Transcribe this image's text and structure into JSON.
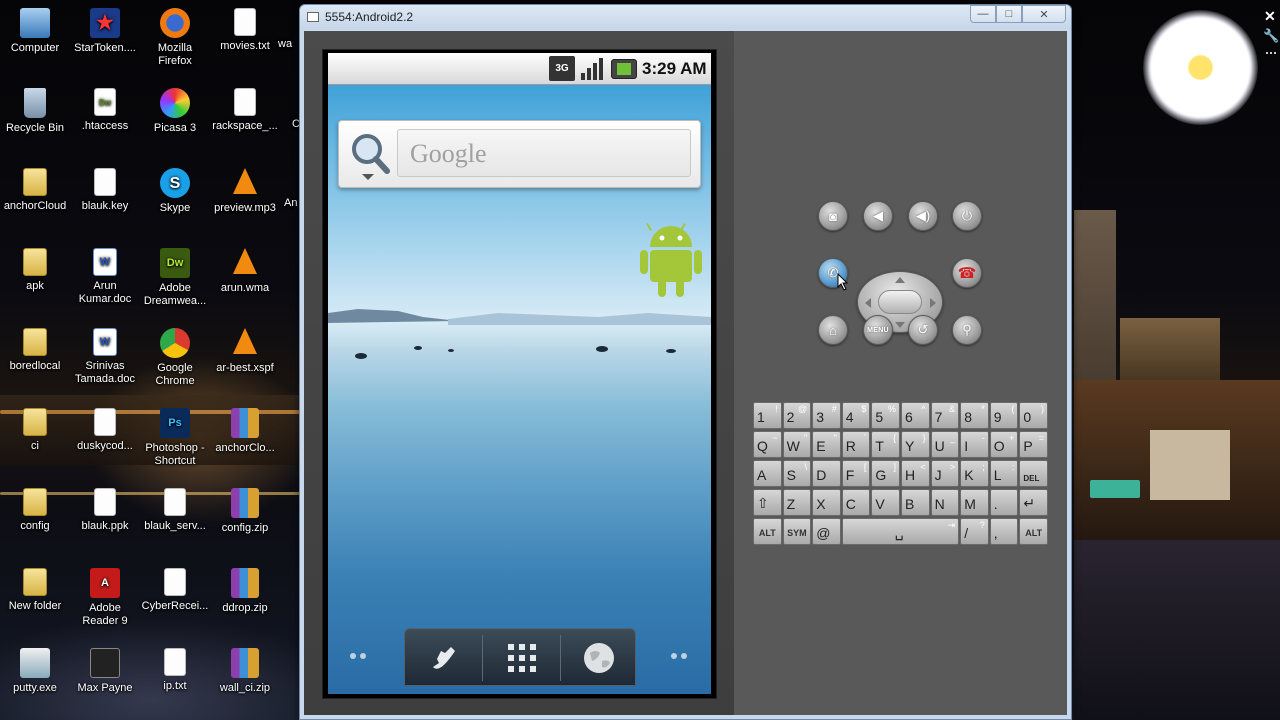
{
  "window": {
    "title": "5554:Android2.2",
    "minimize_label": "—",
    "maximize_label": "□",
    "close_label": "✕"
  },
  "desktop_icons": [
    {
      "label": "Computer",
      "kind": "computer"
    },
    {
      "label": "StarToken....",
      "kind": "star"
    },
    {
      "label": "Mozilla Firefox",
      "kind": "firefox"
    },
    {
      "label": "movies.txt",
      "kind": "file"
    },
    {
      "label": "Recycle Bin",
      "kind": "recycle"
    },
    {
      "label": ".htaccess",
      "kind": "dw"
    },
    {
      "label": "Picasa 3",
      "kind": "picasa"
    },
    {
      "label": "rackspace_...",
      "kind": "file"
    },
    {
      "label": "anchorCloud",
      "kind": "folder"
    },
    {
      "label": "blauk.key",
      "kind": "file"
    },
    {
      "label": "Skype",
      "kind": "skype"
    },
    {
      "label": "preview.mp3",
      "kind": "vlc"
    },
    {
      "label": "apk",
      "kind": "folder"
    },
    {
      "label": "Arun Kumar.doc",
      "kind": "doc"
    },
    {
      "label": "Adobe Dreamwea...",
      "kind": "dreamweaver"
    },
    {
      "label": "arun.wma",
      "kind": "vlc"
    },
    {
      "label": "boredlocal",
      "kind": "folder"
    },
    {
      "label": "Srinivas Tamada.doc",
      "kind": "doc"
    },
    {
      "label": "Google Chrome",
      "kind": "chrome"
    },
    {
      "label": "ar-best.xspf",
      "kind": "vlc"
    },
    {
      "label": "ci",
      "kind": "folder"
    },
    {
      "label": "duskycod...",
      "kind": "file"
    },
    {
      "label": "Photoshop - Shortcut",
      "kind": "photoshop"
    },
    {
      "label": "anchorClo...",
      "kind": "zip"
    },
    {
      "label": "config",
      "kind": "folder"
    },
    {
      "label": "blauk.ppk",
      "kind": "file"
    },
    {
      "label": "blauk_serv...",
      "kind": "file"
    },
    {
      "label": "config.zip",
      "kind": "zip"
    },
    {
      "label": "New folder",
      "kind": "folder"
    },
    {
      "label": "Adobe Reader 9",
      "kind": "reader"
    },
    {
      "label": "CyberRecei...",
      "kind": "file"
    },
    {
      "label": "ddrop.zip",
      "kind": "zip"
    },
    {
      "label": "putty.exe",
      "kind": "putty"
    },
    {
      "label": "Max Payne",
      "kind": "maxpayne"
    },
    {
      "label": "ip.txt",
      "kind": "file"
    },
    {
      "label": "wall_ci.zip",
      "kind": "zip"
    }
  ],
  "desktop_partial_labels": [
    "wa",
    "An",
    "C"
  ],
  "phone": {
    "status": {
      "network": "3G",
      "time": "3:29 AM"
    },
    "search": {
      "placeholder": "Google"
    },
    "dock": [
      "phone-icon",
      "apps-grid-icon",
      "browser-globe-icon"
    ]
  },
  "hardware_buttons": {
    "menu_label": "MENU",
    "top_row": [
      "camera-icon",
      "volume-down-icon",
      "volume-up-icon",
      "power-icon"
    ],
    "bottom_row": [
      "home-icon",
      "menu-button",
      "back-icon",
      "search-icon"
    ]
  },
  "keyboard": {
    "row1": [
      {
        "main": "1",
        "sub": "!"
      },
      {
        "main": "2",
        "sub": "@"
      },
      {
        "main": "3",
        "sub": "#"
      },
      {
        "main": "4",
        "sub": "$"
      },
      {
        "main": "5",
        "sub": "%"
      },
      {
        "main": "6",
        "sub": "^"
      },
      {
        "main": "7",
        "sub": "&"
      },
      {
        "main": "8",
        "sub": "*"
      },
      {
        "main": "9",
        "sub": "("
      },
      {
        "main": "0",
        "sub": ")"
      }
    ],
    "row2": [
      {
        "main": "Q",
        "sub": "~"
      },
      {
        "main": "W",
        "sub": "\""
      },
      {
        "main": "E",
        "sub": "\""
      },
      {
        "main": "R",
        "sub": "`"
      },
      {
        "main": "T",
        "sub": "{"
      },
      {
        "main": "Y",
        "sub": "}"
      },
      {
        "main": "U",
        "sub": "_"
      },
      {
        "main": "I",
        "sub": "-"
      },
      {
        "main": "O",
        "sub": "+"
      },
      {
        "main": "P",
        "sub": "="
      }
    ],
    "row3": [
      {
        "main": "A",
        "sub": ""
      },
      {
        "main": "S",
        "sub": "\\"
      },
      {
        "main": "D",
        "sub": ""
      },
      {
        "main": "F",
        "sub": "["
      },
      {
        "main": "G",
        "sub": "]"
      },
      {
        "main": "H",
        "sub": "<"
      },
      {
        "main": "J",
        "sub": ">"
      },
      {
        "main": "K",
        "sub": ";"
      },
      {
        "main": "L",
        "sub": ":"
      },
      {
        "main": "DEL",
        "sub": ""
      }
    ],
    "row4": [
      {
        "main": "⇧",
        "sub": ""
      },
      {
        "main": "Z",
        "sub": ""
      },
      {
        "main": "X",
        "sub": ""
      },
      {
        "main": "C",
        "sub": ""
      },
      {
        "main": "V",
        "sub": ""
      },
      {
        "main": "B",
        "sub": ""
      },
      {
        "main": "N",
        "sub": ""
      },
      {
        "main": "M",
        "sub": ""
      },
      {
        "main": ".",
        "sub": ""
      },
      {
        "main": "↵",
        "sub": ""
      }
    ],
    "row5": [
      {
        "main": "ALT",
        "sub": ""
      },
      {
        "main": "SYM",
        "sub": ""
      },
      {
        "main": "@",
        "sub": ""
      },
      {
        "main": "␣",
        "sub": "⇥"
      },
      {
        "main": "/",
        "sub": "?"
      },
      {
        "main": ",",
        "sub": ""
      },
      {
        "main": "ALT",
        "sub": ""
      }
    ]
  },
  "colors": {
    "emulator_skin": "#595959",
    "window_frame": "#c9d8ea",
    "android_green": "#a4c639",
    "call_end_red": "#d42020"
  }
}
